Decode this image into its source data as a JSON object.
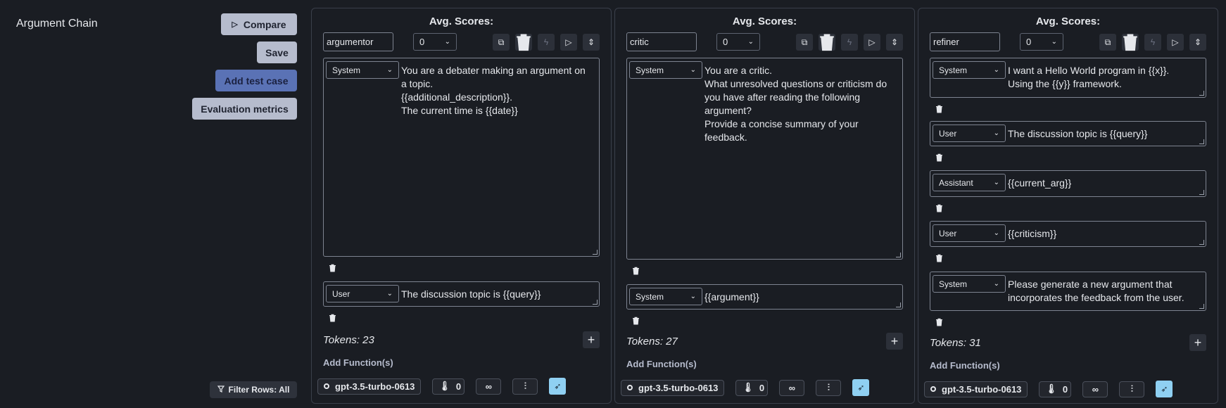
{
  "app": {
    "title": "Argument Chain"
  },
  "sidebar": {
    "compare": "Compare",
    "save": "Save",
    "add_test_case": "Add test case",
    "evaluation_metrics": "Evaluation metrics",
    "filter_rows": "Filter Rows: All"
  },
  "panels": [
    {
      "title": "Avg. Scores:",
      "name": "argumentor",
      "score": "0",
      "messages": [
        {
          "role": "System",
          "text": "You are a debater making an argument on a topic.\n{{additional_description}}.\nThe current time is {{date}}"
        },
        {
          "role": "User",
          "text": "The discussion topic is {{query}}"
        }
      ],
      "tokens": "Tokens: 23",
      "add_functions": "Add Function(s)",
      "model": "gpt-3.5-turbo-0613",
      "temperature": "0"
    },
    {
      "title": "Avg. Scores:",
      "name": "critic",
      "score": "0",
      "messages": [
        {
          "role": "System",
          "text": "You are a critic.\nWhat unresolved questions or criticism do you have after reading the following argument?\nProvide a concise summary of your feedback."
        },
        {
          "role": "System",
          "text": "{{argument}}"
        }
      ],
      "tokens": "Tokens: 27",
      "add_functions": "Add Function(s)",
      "model": "gpt-3.5-turbo-0613",
      "temperature": "0"
    },
    {
      "title": "Avg. Scores:",
      "name": "refiner",
      "score": "0",
      "messages": [
        {
          "role": "System",
          "text": "I want a Hello World program in {{x}}.\nUsing the {{y}} framework."
        },
        {
          "role": "User",
          "text": "The discussion topic is {{query}}"
        },
        {
          "role": "Assistant",
          "text": "{{current_arg}}"
        },
        {
          "role": "User",
          "text": "{{criticism}}"
        },
        {
          "role": "System",
          "text": "Please generate a new argument that incorporates the feedback from the user."
        }
      ],
      "tokens": "Tokens: 31",
      "add_functions": "Add Function(s)",
      "model": "gpt-3.5-turbo-0613",
      "temperature": "0"
    }
  ],
  "icons": {
    "infinity": "∞",
    "plus": "+"
  }
}
